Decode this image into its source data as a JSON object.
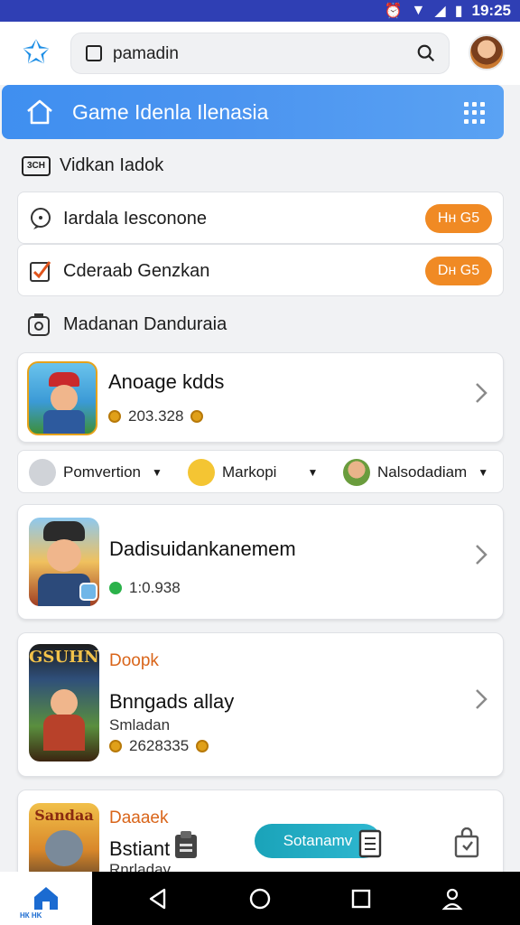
{
  "status": {
    "time": "19:25"
  },
  "search": {
    "text": "pamadin"
  },
  "banner": {
    "title": "Game Idenla Ilenasia"
  },
  "section": {
    "badge": "3CH",
    "title": "Vidkan Iadok"
  },
  "rows": [
    {
      "label": "Iardala Iesconone",
      "pill": "Hн G5"
    },
    {
      "label": "Cderaab Genzkan",
      "pill": "Dн G5"
    }
  ],
  "plain_row": {
    "label": "Madanan Danduraia"
  },
  "cards": [
    {
      "title": "Anoage kdds",
      "meta": "203.328"
    },
    {
      "title": "Dadisuidankanemem",
      "meta": "1:0.938"
    },
    {
      "tag": "Doopk",
      "thumb_text": "GSUHNI",
      "title": "Bnngads allay",
      "sub": "Smladan",
      "meta": "2628335"
    },
    {
      "tag": "Daaaek",
      "thumb_text": "Sandaa",
      "title": "Bstiant",
      "sub": "Rnrladay"
    }
  ],
  "filters": [
    {
      "label": "Pomvertion"
    },
    {
      "label": "Markopi"
    },
    {
      "label": "Nalsodadiam"
    }
  ],
  "fab": {
    "label": "Sotanamv"
  },
  "nav": {
    "home_caption": "НК HK"
  },
  "colors": {
    "accent": "#4b94f0",
    "pill": "#f08a24",
    "status": "#2f3fb4",
    "tag": "#d9651a"
  }
}
